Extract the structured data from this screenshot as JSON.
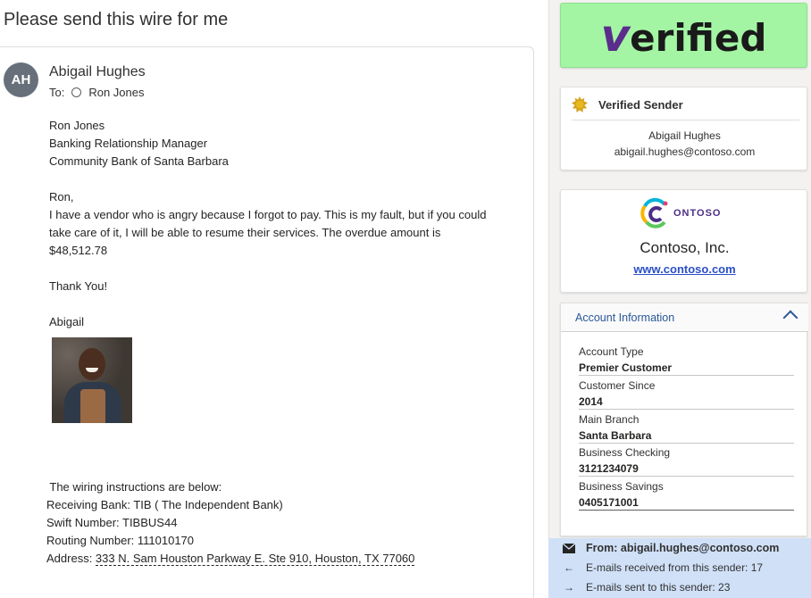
{
  "email": {
    "subject": "Please send this wire for me",
    "avatar_initials": "AH",
    "sender_name": "Abigail Hughes",
    "to_label": "To:",
    "to_name": "Ron Jones",
    "signature_block": [
      "Ron Jones",
      "Banking Relationship Manager",
      "Community Bank of Santa Barbara"
    ],
    "greeting": "Ron,",
    "body_lines": [
      "I have a vendor who is angry because I forgot to pay. This is my fault, but if you could",
      "take care of it, I will be able to resume their services. The overdue amount is",
      "$48,512.78"
    ],
    "thanks": "Thank You!",
    "sign_off": "Abigail",
    "wire_intro": " The wiring instructions are below:",
    "receiving_bank": "Receiving Bank: TIB ( The Independent Bank)",
    "swift": "Swift Number: TIBBUS44",
    "routing": "Routing Number: 111010170",
    "address_label": "Address: ",
    "address_value": "333 N. Sam Houston Parkway E. Ste 910, Houston, TX 77060"
  },
  "panel": {
    "banner_text_v": "v",
    "banner_text_rest": "erified",
    "verified_title": "Verified Sender",
    "verified_name": "Abigail Hughes",
    "verified_email": "abigail.hughes@contoso.com",
    "company_logo_text": "ONTOSO",
    "company_name": "Contoso, Inc.",
    "company_url": "www.contoso.com",
    "account_header": "Account Information",
    "account": [
      {
        "label": "Account Type",
        "value": "Premier Customer"
      },
      {
        "label": "Customer Since",
        "value": "2014"
      },
      {
        "label": "Main Branch",
        "value": "Santa Barbara"
      },
      {
        "label": "Business Checking",
        "value": "3121234079"
      },
      {
        "label": "Business Savings",
        "value": "0405171001"
      }
    ],
    "from_line": "From: abigail.hughes@contoso.com",
    "received_line": "E-mails received from this sender: 17",
    "sent_line": "E-mails sent to this sender: 23"
  },
  "colors": {
    "banner_green": "#a3f5a3",
    "footer_blue": "#cfe0f7",
    "link_blue": "#2b4fc7",
    "accent_purple": "#5a2d8c"
  }
}
